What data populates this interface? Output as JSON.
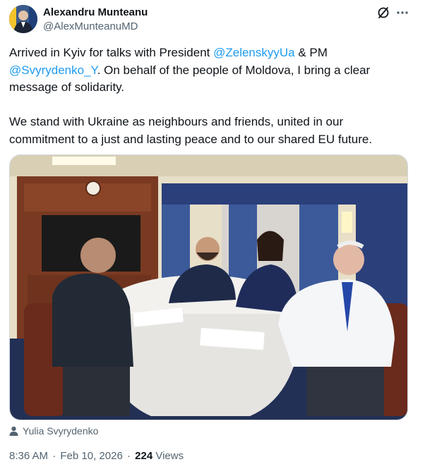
{
  "author": {
    "name": "Alexandru Munteanu",
    "handle": "@AlexMunteanuMD"
  },
  "header_icons": [
    "grok-icon",
    "more-icon"
  ],
  "tweet": {
    "p1_a": "Arrived in Kyiv for talks with President ",
    "mention1": "@ZelenskyyUa",
    "p1_b": " & PM ",
    "mention2": "@Svyrydenko_Y",
    "p1_c": ". On behalf of the people of Moldova, I bring a clear message of solidarity.",
    "p2": "We stand with Ukraine as neighbours and friends, united in our commitment to a just and lasting peace and to our shared EU future."
  },
  "photo_tag": {
    "icon": "person-icon",
    "label": "Yulia Svyrydenko"
  },
  "meta": {
    "time": "8:36 AM",
    "dot1": "·",
    "date": "Feb 10, 2026",
    "dot2": "·",
    "views_count": "224",
    "views_label": "Views"
  },
  "colors": {
    "accent": "#1d9bf0",
    "text": "#0f1419",
    "muted": "#536471"
  }
}
